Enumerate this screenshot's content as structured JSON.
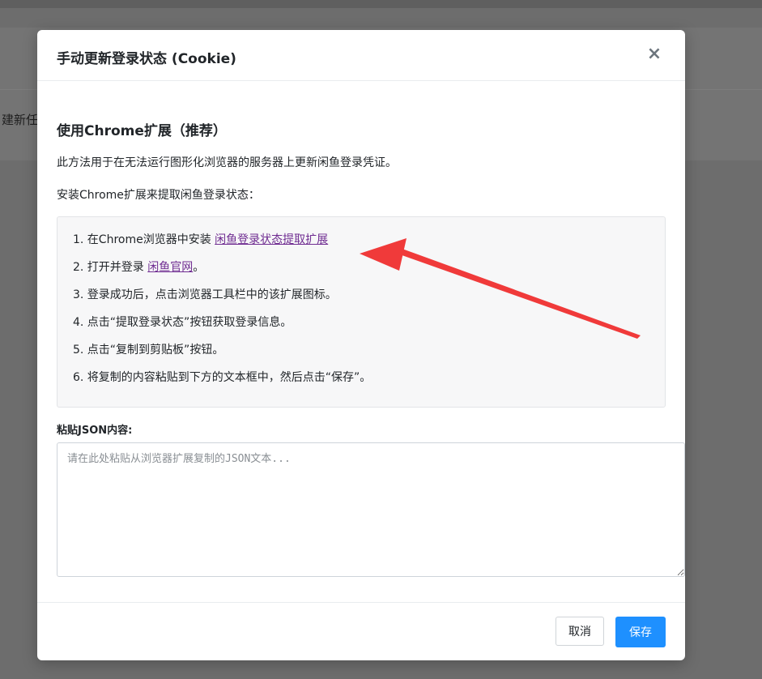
{
  "background": {
    "partial_text": "建新任"
  },
  "modal": {
    "title": "手动更新登录状态 (Cookie)",
    "close_glyph": "×",
    "section_title": "使用Chrome扩展（推荐）",
    "description": "此方法用于在无法运行图形化浏览器的服务器上更新闲鱼登录凭证。",
    "install_intro": "安装Chrome扩展来提取闲鱼登录状态：",
    "steps": [
      {
        "text": "1. 在Chrome浏览器中安装 ",
        "link": "闲鱼登录状态提取扩展",
        "after": ""
      },
      {
        "text": "2. 打开并登录 ",
        "link": "闲鱼官网",
        "after": "。"
      },
      {
        "text": "3. 登录成功后，点击浏览器工具栏中的该扩展图标。"
      },
      {
        "text": "4. 点击“提取登录状态”按钮获取登录信息。"
      },
      {
        "text": "5. 点击“复制到剪贴板”按钮。"
      },
      {
        "text": "6. 将复制的内容粘贴到下方的文本框中，然后点击“保存”。"
      }
    ],
    "json_label": "粘贴JSON内容:",
    "json_placeholder": "请在此处粘贴从浏览器扩展复制的JSON文本...",
    "json_value": "",
    "cancel_label": "取消",
    "save_label": "保存"
  },
  "colors": {
    "primary": "#1e90ff",
    "link": "#6f2c91",
    "annotation_arrow": "#f03a3a",
    "overlay": "#6b6b6b"
  }
}
